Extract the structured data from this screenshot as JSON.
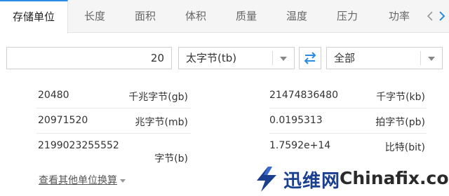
{
  "tabs": [
    {
      "label": "存储单位",
      "active": true
    },
    {
      "label": "长度"
    },
    {
      "label": "面积"
    },
    {
      "label": "体积"
    },
    {
      "label": "质量"
    },
    {
      "label": "温度"
    },
    {
      "label": "压力"
    },
    {
      "label": "功率"
    }
  ],
  "nav": {
    "prev_icon": "chevron-left-icon",
    "next_icon": "chevron-right-icon"
  },
  "converter": {
    "input_value": "20",
    "from_unit": "太字节(tb)",
    "swap_icon": "swap-arrows-icon",
    "to_unit": "全部"
  },
  "results": {
    "left": [
      {
        "value": "20480",
        "unit": "千兆字节(gb)"
      },
      {
        "value": "20971520",
        "unit": "兆字节(mb)"
      },
      {
        "value": "2199023255552",
        "unit": "字节(b)"
      }
    ],
    "right": [
      {
        "value": "21474836480",
        "unit": "千字节(kb)"
      },
      {
        "value": "0.0195313",
        "unit": "拍字节(pb)"
      },
      {
        "value": "1.7592e+14",
        "unit": "比特(bit)"
      }
    ]
  },
  "more_link": "查看其他单位换算",
  "watermark": {
    "brand": "迅维网",
    "site": "Chinafix.com"
  },
  "colors": {
    "accent": "#2a8ce4",
    "tab_bg": "#f5f5f5",
    "watermark_blue": "#1a3f8f"
  }
}
